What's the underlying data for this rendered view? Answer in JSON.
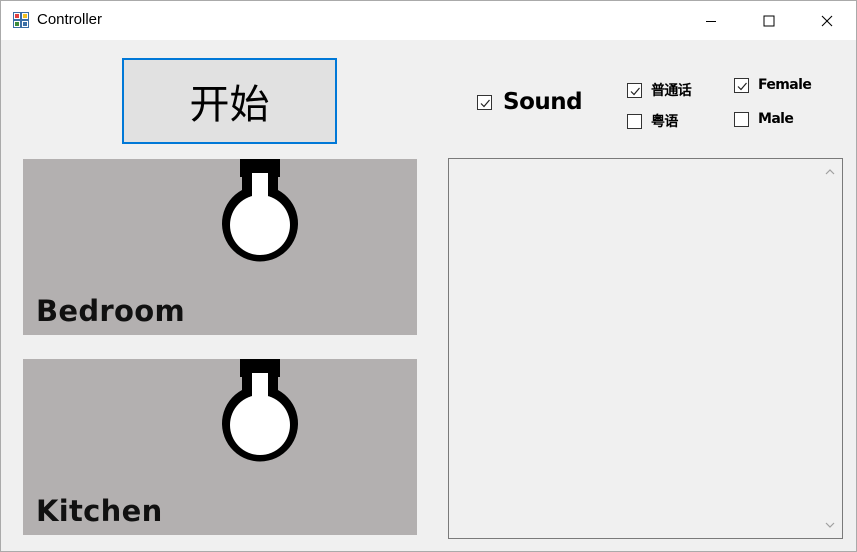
{
  "window": {
    "title": "Controller"
  },
  "controls": {
    "start_label": "开始"
  },
  "options": {
    "sound": {
      "label": "Sound",
      "checked": true
    },
    "mandarin": {
      "label": "普通话",
      "checked": true
    },
    "cantonese": {
      "label": "粤语",
      "checked": false
    },
    "female": {
      "label": "Female",
      "checked": true
    },
    "male": {
      "label": "Male",
      "checked": false
    }
  },
  "rooms": [
    {
      "label": "Bedroom",
      "light": "off"
    },
    {
      "label": "Kitchen",
      "light": "off"
    }
  ],
  "log": {
    "text": ""
  },
  "colors": {
    "accent": "#0078d7",
    "panel": "#b3b0b0",
    "background": "#f0f0f0"
  },
  "icons": {
    "app": "app-icon",
    "minimize": "minimize-icon",
    "maximize": "maximize-icon",
    "close": "close-icon",
    "bulb": "lightbulb-icon"
  }
}
